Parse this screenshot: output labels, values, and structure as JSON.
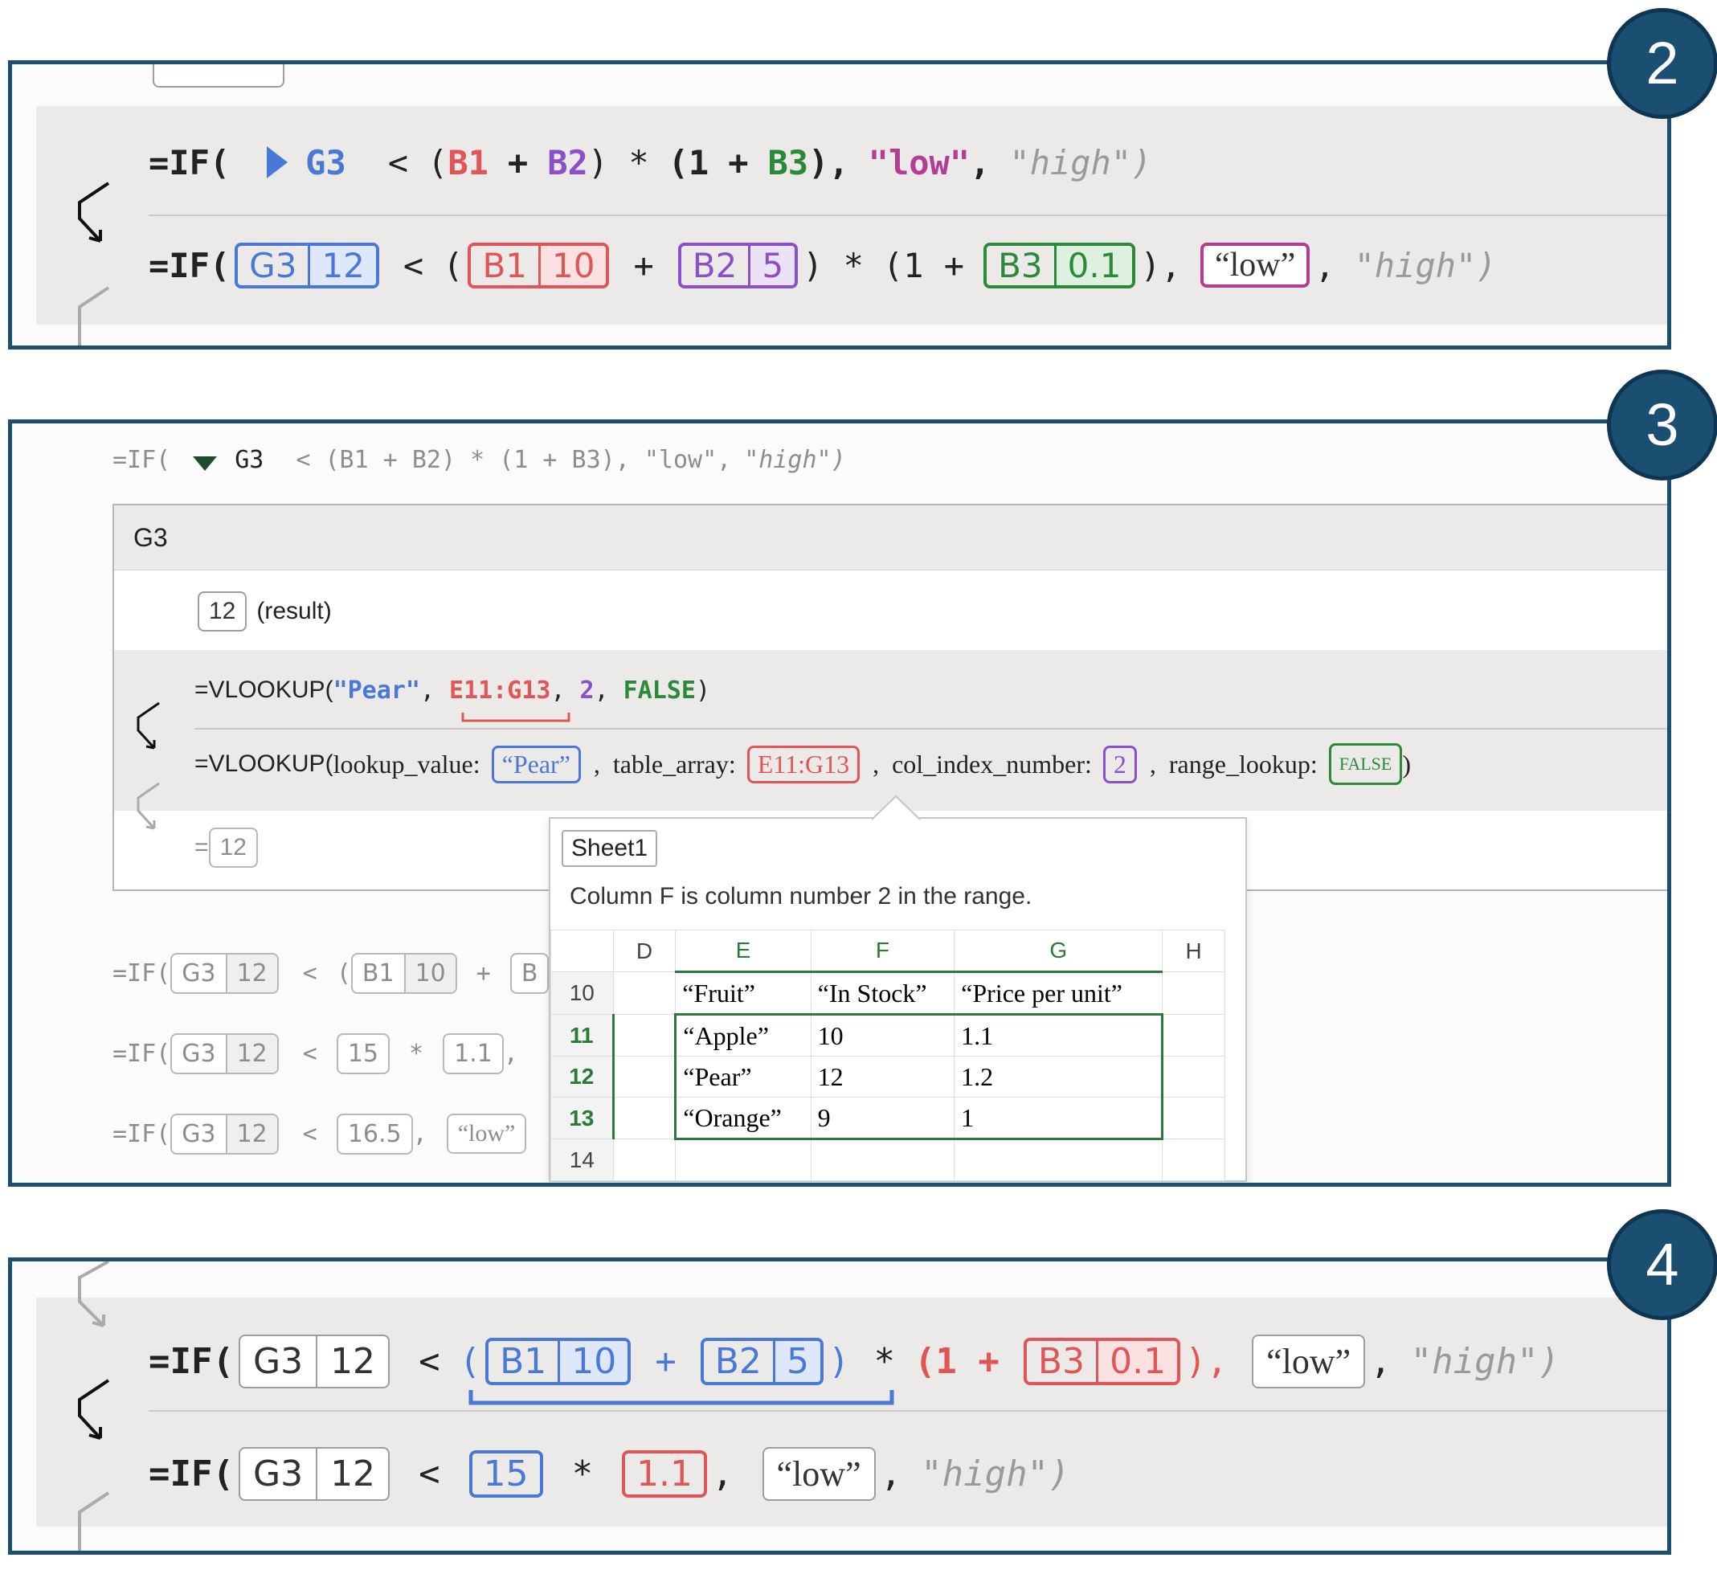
{
  "badges": [
    "2",
    "3",
    "4"
  ],
  "panel2": {
    "row1": {
      "prefix": "=IF(",
      "ref": "G3",
      "op_lt": "<",
      "open": "(",
      "b1": "B1",
      "plus": "+",
      "b2": "B2",
      "close_mul": ") *",
      "paren_one": "(1",
      "plus2": "+",
      "b3": "B3",
      "close_comma": "),",
      "low": "\"low\"",
      "comma": ",",
      "high": "\"high\")"
    },
    "row2": {
      "prefix": "=IF(",
      "g3": "G3",
      "g3_val": "12",
      "op_lt": "<",
      "open": "(",
      "b1": "B1",
      "b1_val": "10",
      "plus": "+",
      "b2": "B2",
      "b2_val": "5",
      "close_mul": ") *",
      "paren_one": "(1 +",
      "b3": "B3",
      "b3_val": "0.1",
      "close_comma": "),",
      "low": "“low”",
      "comma": ",",
      "high": "\"high\")"
    }
  },
  "panel3": {
    "top_formula": {
      "prefix": "=IF(",
      "ref": "G3",
      "rest": "< (B1 + B2) * (1 + B3), \"low\",",
      "high": "\"high\")"
    },
    "card": {
      "header": "G3",
      "result_value": "12",
      "result_label": "(result)",
      "vlookup": {
        "prefix": "=VLOOKUP(",
        "arg1": "\"Pear\"",
        "sep1": ",",
        "arg2": "E11:G13",
        "sep2": ",",
        "arg3": "2",
        "sep3": ",",
        "arg4": "FALSE",
        "close": ")"
      },
      "vlookup_named": {
        "prefix": "=VLOOKUP(",
        "lookup_label": "lookup_value:",
        "lookup_val": "“Pear”",
        "table_label": "table_array:",
        "table_val": "E11:G13",
        "col_label": "col_index_number:",
        "col_val": "2",
        "range_label": "range_lookup:",
        "range_val": "FALSE",
        "comma": ",",
        "close": ")"
      },
      "eq": "=",
      "final_value": "12"
    },
    "tooltip": {
      "sheet": "Sheet1",
      "message": "Column F is column number 2 in the range.",
      "columns": [
        "D",
        "E",
        "F",
        "G",
        "H"
      ],
      "rows": [
        {
          "num": "10",
          "e": "“Fruit”",
          "f": "“In Stock”",
          "g": "“Price per unit”"
        },
        {
          "num": "11",
          "e": "“Apple”",
          "f": "10",
          "g": "1.1"
        },
        {
          "num": "12",
          "e": "“Pear”",
          "f": "12",
          "g": "1.2"
        },
        {
          "num": "13",
          "e": "“Orange”",
          "f": "9",
          "g": "1"
        },
        {
          "num": "14",
          "e": "",
          "f": "",
          "g": ""
        }
      ]
    },
    "steps": [
      {
        "prefix": "=IF(",
        "g3": "G3",
        "g3_val": "12",
        "lt": "<",
        "open": "(",
        "b1": "B1",
        "b1_val": "10",
        "plus": "+",
        "b2": "B"
      },
      {
        "prefix": "=IF(",
        "g3": "G3",
        "g3_val": "12",
        "lt": "<",
        "v1": "15",
        "mul": "*",
        "v2": "1.1",
        "comma": ","
      },
      {
        "prefix": "=IF(",
        "g3": "G3",
        "g3_val": "12",
        "lt": "<",
        "v1": "16.5",
        "comma": ",",
        "low": "“low”"
      }
    ]
  },
  "panel4": {
    "row1": {
      "prefix": "=IF(",
      "g3": "G3",
      "g3_val": "12",
      "lt": "<",
      "open": "(",
      "b1": "B1",
      "b1_val": "10",
      "plus": "+",
      "b2": "B2",
      "b2_val": "5",
      "close": ")",
      "mul": "*",
      "paren_one": "(1 +",
      "b3": "B3",
      "b3_val": "0.1",
      "close_comma": "),",
      "low": "“low”",
      "comma": ",",
      "high": "\"high\")"
    },
    "row2": {
      "prefix": "=IF(",
      "g3": "G3",
      "g3_val": "12",
      "lt": "<",
      "v1": "15",
      "mul": "*",
      "v2": "1.1",
      "comma": ",",
      "low": "“low”",
      "comma2": ",",
      "high": "\"high\")"
    }
  }
}
